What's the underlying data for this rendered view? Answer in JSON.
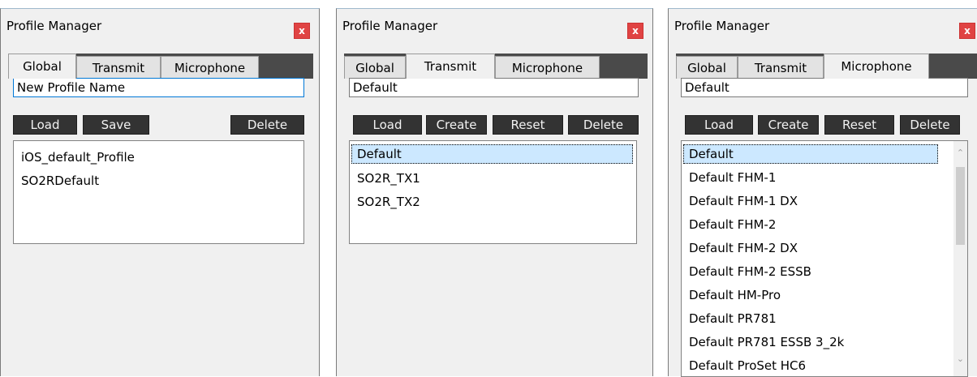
{
  "panels": [
    {
      "title": "Profile Manager",
      "close": "x",
      "tabs": [
        "Global",
        "Transmit",
        "Microphone"
      ],
      "active_tab": "Global",
      "name_value": "New Profile Name",
      "buttons": [
        "Load",
        "Save",
        "Delete"
      ],
      "profiles": [
        "iOS_default_Profile",
        "SO2RDefault"
      ]
    },
    {
      "title": "Profile Manager",
      "close": "x",
      "tabs": [
        "Global",
        "Transmit",
        "Microphone"
      ],
      "active_tab": "Transmit",
      "name_value": "Default",
      "buttons": [
        "Load",
        "Create",
        "Reset",
        "Delete"
      ],
      "profiles": [
        "Default",
        "SO2R_TX1",
        "SO2R_TX2"
      ],
      "selected": "Default"
    },
    {
      "title": "Profile Manager",
      "close": "x",
      "tabs": [
        "Global",
        "Transmit",
        "Microphone"
      ],
      "active_tab": "Microphone",
      "name_value": "Default",
      "buttons": [
        "Load",
        "Create",
        "Reset",
        "Delete"
      ],
      "profiles": [
        "Default",
        "Default FHM-1",
        "Default FHM-1 DX",
        "Default FHM-2",
        "Default FHM-2 DX",
        "Default FHM-2 ESSB",
        "Default HM-Pro",
        "Default PR781",
        "Default PR781 ESSB 3_2k",
        "Default ProSet HC6"
      ],
      "selected": "Default"
    }
  ],
  "colors": {
    "button_bg": "#333333",
    "tabbar_bg": "#4a4a4a",
    "close_bg": "#e04343",
    "selection_bg": "#cce8ff",
    "focus_border": "#0078d7"
  }
}
